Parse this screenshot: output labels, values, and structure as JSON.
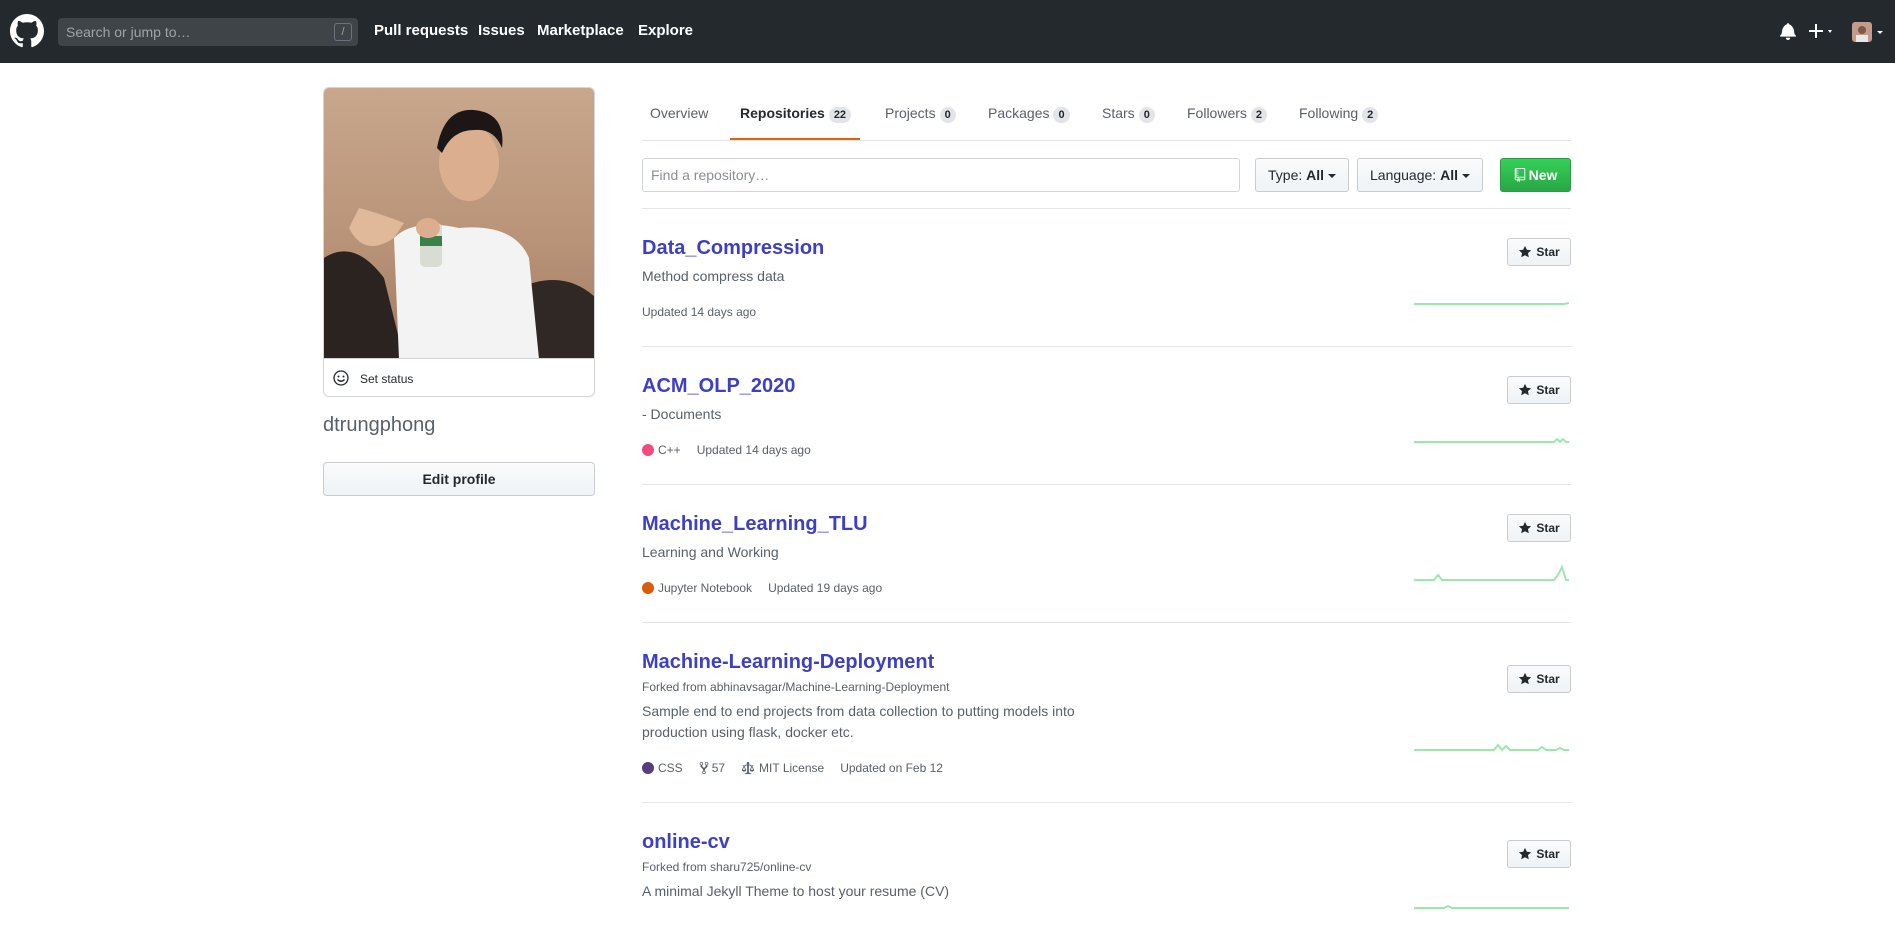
{
  "header": {
    "search_placeholder": "Search or jump to…",
    "search_shortcut": "/",
    "nav": [
      "Pull requests",
      "Issues",
      "Marketplace",
      "Explore"
    ],
    "icons": [
      "github-logo",
      "bell-icon",
      "plus-icon",
      "avatar"
    ]
  },
  "profile": {
    "status_label": "Set status",
    "username": "dtrungphong",
    "edit_label": "Edit profile"
  },
  "tabs": [
    {
      "label": "Overview",
      "count": null
    },
    {
      "label": "Repositories",
      "count": "22",
      "selected": true
    },
    {
      "label": "Projects",
      "count": "0"
    },
    {
      "label": "Packages",
      "count": "0"
    },
    {
      "label": "Stars",
      "count": "0"
    },
    {
      "label": "Followers",
      "count": "2"
    },
    {
      "label": "Following",
      "count": "2"
    }
  ],
  "filters": {
    "search_placeholder": "Find a repository…",
    "type_label": "Type:",
    "type_value": "All",
    "language_label": "Language:",
    "language_value": "All",
    "new_label": "New"
  },
  "star_label": "Star",
  "repos": [
    {
      "name": "Data_Compression",
      "description": "Method compress data",
      "updated": "Updated 14 days ago"
    },
    {
      "name": "ACM_OLP_2020",
      "description": "- Documents",
      "language": "C++",
      "language_color": "#f34b7d",
      "updated": "Updated 14 days ago"
    },
    {
      "name": "Machine_Learning_TLU",
      "description": "Learning and Working",
      "language": "Jupyter Notebook",
      "language_color": "#DA5B0B",
      "updated": "Updated 19 days ago"
    },
    {
      "name": "Machine-Learning-Deployment",
      "fork": "Forked from abhinavsagar/Machine-Learning-Deployment",
      "description": "Sample end to end projects from data collection to putting models into production using flask, docker etc.",
      "language": "CSS",
      "language_color": "#563d7c",
      "forks": "57",
      "license": "MIT License",
      "updated": "Updated on Feb 12"
    },
    {
      "name": "online-cv",
      "fork": "Forked from sharu725/online-cv",
      "description": "A minimal Jekyll Theme to host your resume (CV)"
    }
  ],
  "colors": {
    "header_bg": "#24292e",
    "link": "#3d3fc4",
    "accent": "#e36209",
    "green": "#28a745",
    "spark": "#9be9a8"
  }
}
